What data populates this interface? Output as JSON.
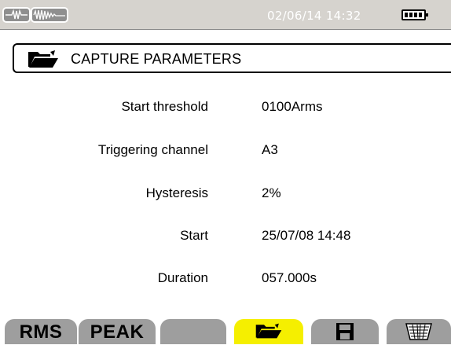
{
  "status_bar": {
    "datetime": "02/06/14 14:32",
    "icons": [
      "waveform-icon",
      "transient-icon",
      "battery-icon"
    ],
    "battery_level": 1.0
  },
  "header": {
    "title": "CAPTURE PARAMETERS",
    "icon": "folder-open-icon"
  },
  "params": [
    {
      "label": "Start threshold",
      "value": "0100Arms"
    },
    {
      "label": "Triggering channel",
      "value": "A3"
    },
    {
      "label": "Hysteresis",
      "value": "2%"
    },
    {
      "label": "Start",
      "value": "25/07/08 14:48"
    },
    {
      "label": "Duration",
      "value": "057.000s"
    }
  ],
  "softkeys": {
    "rms": "RMS",
    "peak": "PEAK",
    "blank": "",
    "open": "folder-open-icon",
    "save": "floppy-disk-icon",
    "delete": "trash-icon",
    "active_color": "#f5ef00",
    "inactive_color": "#9e9e9e"
  }
}
